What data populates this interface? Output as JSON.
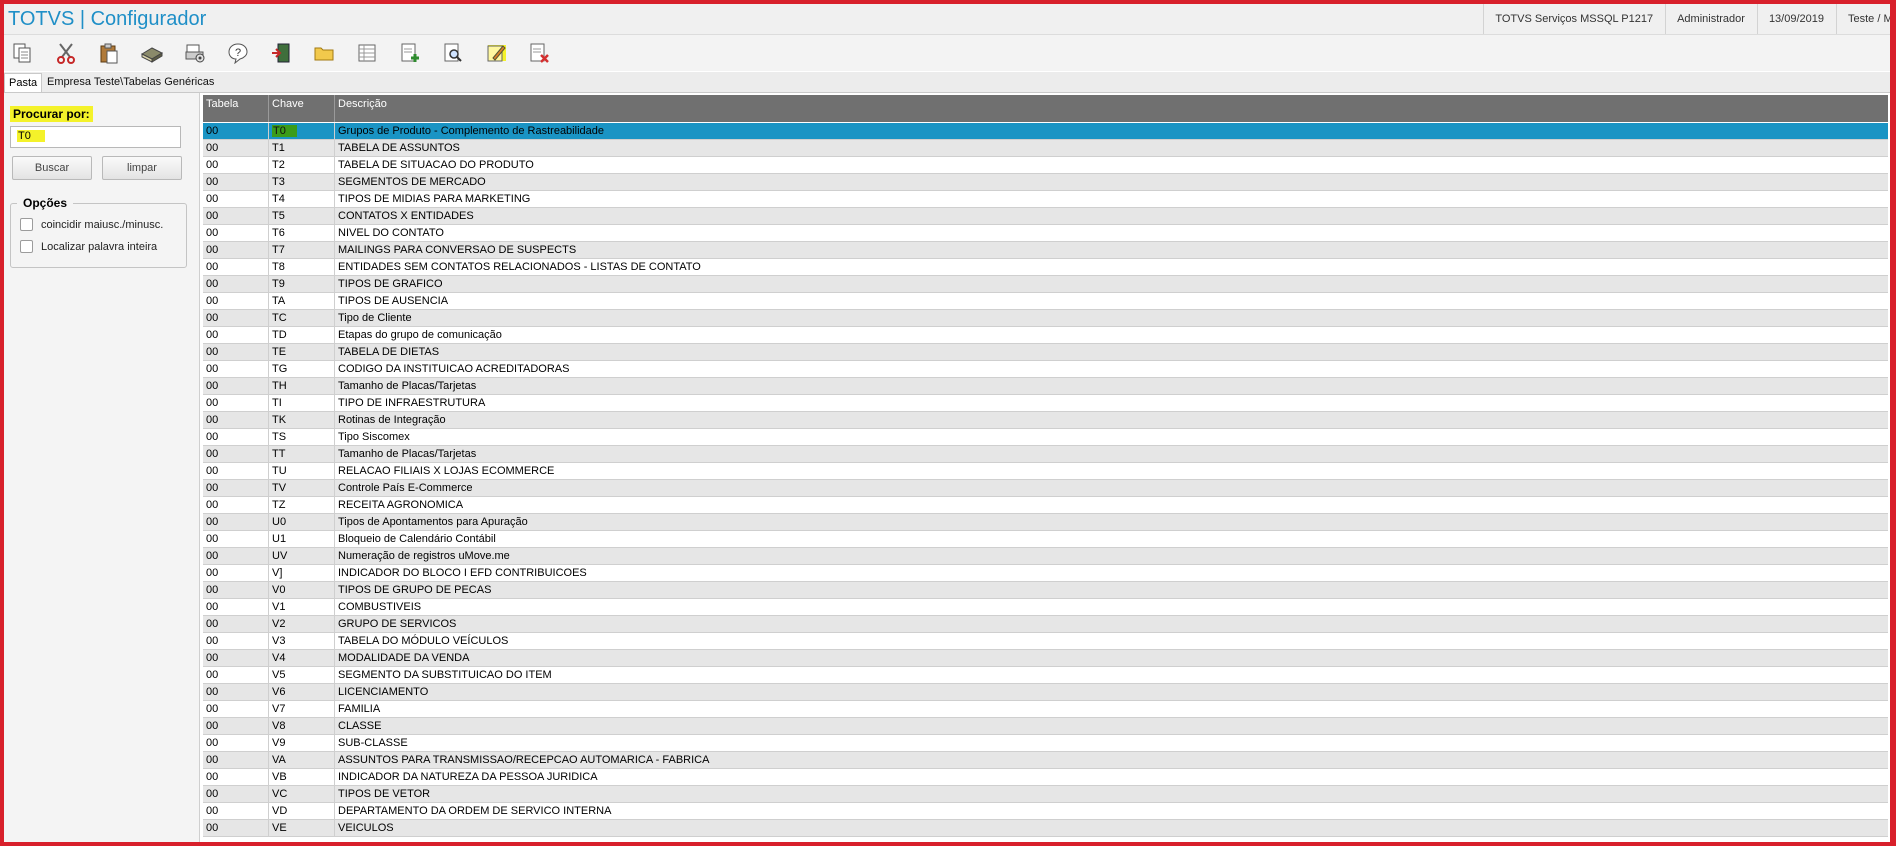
{
  "window": {
    "title": "TOTVS | Configurador",
    "status": [
      "TOTVS Serviços MSSQL P1217",
      "Administrador",
      "13/09/2019",
      "Teste / Matriz"
    ]
  },
  "toolbar": {
    "buttons": [
      "copy",
      "cut",
      "paste",
      "book",
      "print-setup",
      "help",
      "exit",
      "folder",
      "spreadsheet",
      "add-document",
      "preview",
      "edit",
      "delete-document"
    ],
    "highlighted": [
      "edit"
    ]
  },
  "tabs": {
    "active": "Pasta",
    "path": "Empresa Teste\\Tabelas Genéricas"
  },
  "search": {
    "label": "Procurar por:",
    "value": "T0",
    "buscar_label": "Buscar",
    "limpar_label": "limpar",
    "options_title": "Opções",
    "opt_case": "coincidir maiusc./minusc.",
    "opt_word": "Localizar palavra inteira"
  },
  "grid": {
    "headers": [
      "Tabela",
      "Chave",
      "Descrição"
    ],
    "selected_index": 0,
    "rows": [
      [
        "00",
        "T0",
        "Grupos de Produto - Complemento de Rastreabilidade"
      ],
      [
        "00",
        "T1",
        "TABELA DE ASSUNTOS"
      ],
      [
        "00",
        "T2",
        "TABELA DE SITUACAO DO PRODUTO"
      ],
      [
        "00",
        "T3",
        "SEGMENTOS DE MERCADO"
      ],
      [
        "00",
        "T4",
        "TIPOS DE MIDIAS PARA MARKETING"
      ],
      [
        "00",
        "T5",
        "CONTATOS X ENTIDADES"
      ],
      [
        "00",
        "T6",
        "NIVEL DO CONTATO"
      ],
      [
        "00",
        "T7",
        "MAILINGS PARA CONVERSAO DE SUSPECTS"
      ],
      [
        "00",
        "T8",
        "ENTIDADES SEM CONTATOS RELACIONADOS - LISTAS DE CONTATO"
      ],
      [
        "00",
        "T9",
        "TIPOS DE GRAFICO"
      ],
      [
        "00",
        "TA",
        "TIPOS DE AUSENCIA"
      ],
      [
        "00",
        "TC",
        "Tipo de Cliente"
      ],
      [
        "00",
        "TD",
        "Etapas do grupo de comunicação"
      ],
      [
        "00",
        "TE",
        "TABELA DE DIETAS"
      ],
      [
        "00",
        "TG",
        "CODIGO DA INSTITUICAO ACREDITADORAS"
      ],
      [
        "00",
        "TH",
        "Tamanho de Placas/Tarjetas"
      ],
      [
        "00",
        "TI",
        "TIPO DE INFRAESTRUTURA"
      ],
      [
        "00",
        "TK",
        "Rotinas de Integração"
      ],
      [
        "00",
        "TS",
        "Tipo Siscomex"
      ],
      [
        "00",
        "TT",
        "Tamanho de Placas/Tarjetas"
      ],
      [
        "00",
        "TU",
        "RELACAO FILIAIS X LOJAS ECOMMERCE"
      ],
      [
        "00",
        "TV",
        "Controle País E-Commerce"
      ],
      [
        "00",
        "TZ",
        "RECEITA AGRONOMICA"
      ],
      [
        "00",
        "U0",
        "Tipos de Apontamentos para Apuração"
      ],
      [
        "00",
        "U1",
        "Bloqueio de Calendário Contábil"
      ],
      [
        "00",
        "UV",
        "Numeração de registros uMove.me"
      ],
      [
        "00",
        "V]",
        "INDICADOR DO BLOCO I EFD CONTRIBUICOES"
      ],
      [
        "00",
        "V0",
        "TIPOS DE GRUPO DE PECAS"
      ],
      [
        "00",
        "V1",
        "COMBUSTIVEIS"
      ],
      [
        "00",
        "V2",
        "GRUPO DE SERVICOS"
      ],
      [
        "00",
        "V3",
        "TABELA DO MÓDULO VEÍCULOS"
      ],
      [
        "00",
        "V4",
        "MODALIDADE DA VENDA"
      ],
      [
        "00",
        "V5",
        "SEGMENTO DA SUBSTITUICAO DO ITEM"
      ],
      [
        "00",
        "V6",
        "LICENCIAMENTO"
      ],
      [
        "00",
        "V7",
        "FAMILIA"
      ],
      [
        "00",
        "V8",
        "CLASSE"
      ],
      [
        "00",
        "V9",
        "SUB-CLASSE"
      ],
      [
        "00",
        "VA",
        "ASSUNTOS PARA TRANSMISSAO/RECEPCAO AUTOMARICA - FABRICA"
      ],
      [
        "00",
        "VB",
        "INDICADOR DA NATUREZA DA PESSOA JURIDICA"
      ],
      [
        "00",
        "VC",
        "TIPOS DE VETOR"
      ],
      [
        "00",
        "VD",
        "DEPARTAMENTO DA ORDEM DE SERVICO INTERNA"
      ],
      [
        "00",
        "VE",
        "VEICULOS"
      ]
    ]
  }
}
